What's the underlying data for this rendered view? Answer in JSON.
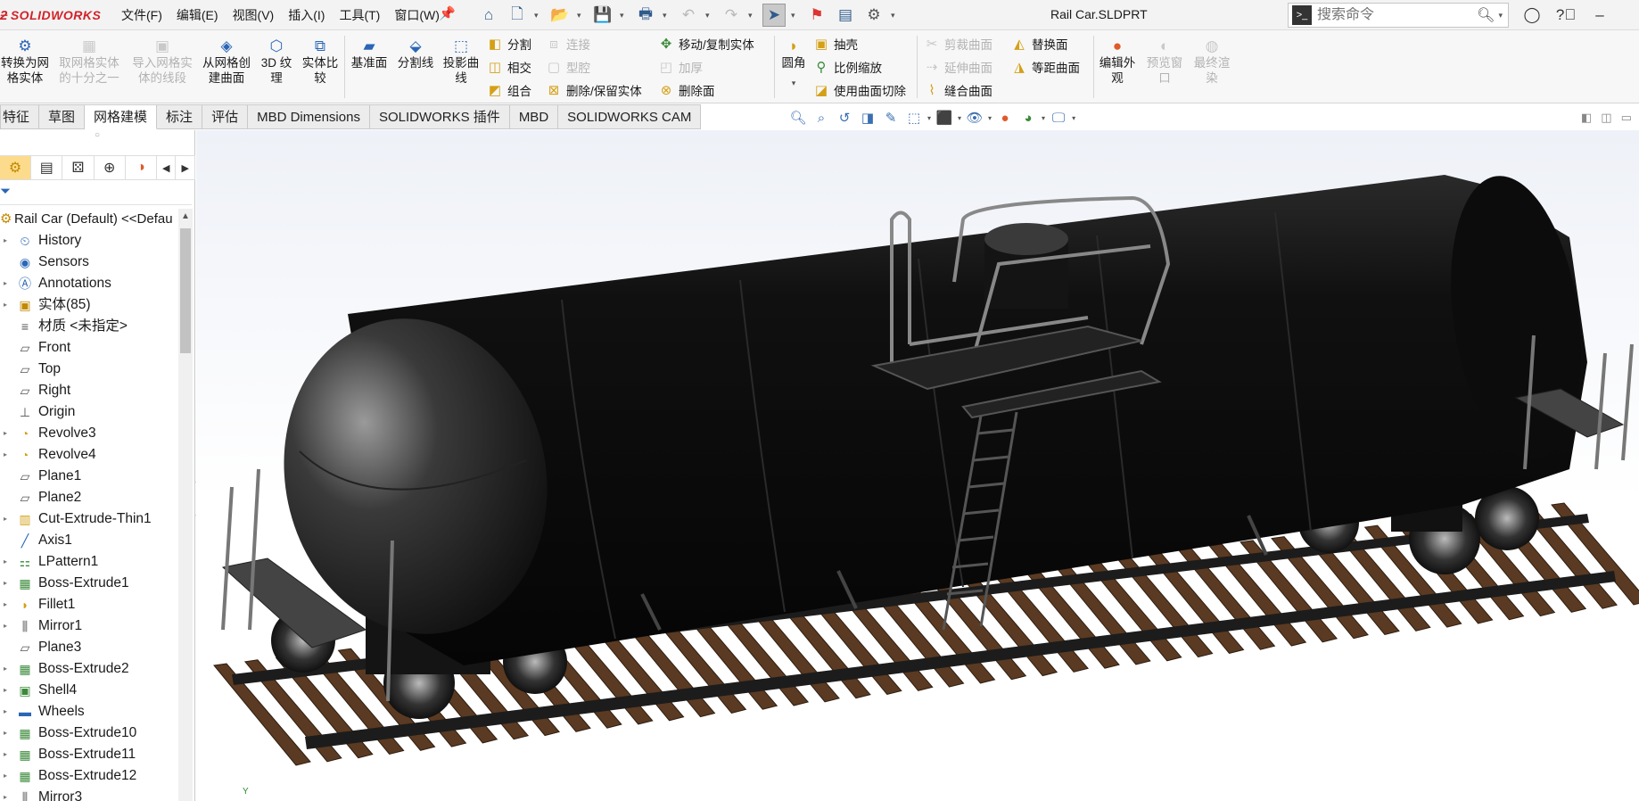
{
  "app": {
    "logo": "SOLIDWORKS",
    "document_title": "Rail Car.SLDPRT"
  },
  "menu": [
    {
      "label": "文件(F)"
    },
    {
      "label": "编辑(E)"
    },
    {
      "label": "视图(V)"
    },
    {
      "label": "插入(I)"
    },
    {
      "label": "工具(T)"
    },
    {
      "label": "窗口(W)"
    }
  ],
  "quick_access_icons": [
    "home-icon",
    "new-document-icon",
    "open-icon",
    "save-icon",
    "print-icon",
    "undo-icon",
    "redo-icon",
    "select-cursor-icon",
    "rebuild-icon",
    "file-properties-icon",
    "options-gear-icon"
  ],
  "search": {
    "placeholder": "搜索命令"
  },
  "ribbon": {
    "large_buttons": [
      {
        "label": "转换为网格实体",
        "enabled": true
      },
      {
        "label": "取网格实体的十分之一",
        "enabled": false
      },
      {
        "label": "导入网格实体的线段",
        "enabled": false
      },
      {
        "label": "从网格创建曲面",
        "enabled": true
      },
      {
        "label": "3D 纹理",
        "enabled": true
      },
      {
        "label": "实体比较",
        "enabled": true
      },
      {
        "label": "基准面",
        "enabled": true
      },
      {
        "label": "分割线",
        "enabled": true
      },
      {
        "label": "投影曲线",
        "enabled": true
      }
    ],
    "small_buttons_col1": [
      {
        "label": "分割",
        "enabled": true
      },
      {
        "label": "相交",
        "enabled": true
      },
      {
        "label": "组合",
        "enabled": true
      }
    ],
    "small_buttons_col2": [
      {
        "label": "连接",
        "enabled": false
      },
      {
        "label": "型腔",
        "enabled": false
      },
      {
        "label": "删除/保留实体",
        "enabled": true
      }
    ],
    "small_buttons_col3": [
      {
        "label": "移动/复制实体",
        "enabled": true
      },
      {
        "label": "加厚",
        "enabled": false
      },
      {
        "label": "删除面",
        "enabled": true
      }
    ],
    "fillet_label": "圆角",
    "small_buttons_col4": [
      {
        "label": "抽壳",
        "enabled": true
      },
      {
        "label": "比例缩放",
        "enabled": true
      },
      {
        "label": "使用曲面切除",
        "enabled": true
      }
    ],
    "small_buttons_col5": [
      {
        "label": "剪裁曲面",
        "enabled": false
      },
      {
        "label": "延伸曲面",
        "enabled": false
      },
      {
        "label": "缝合曲面",
        "enabled": true
      }
    ],
    "small_buttons_col6": [
      {
        "label": "替换面",
        "enabled": true
      },
      {
        "label": "等距曲面",
        "enabled": true
      }
    ],
    "render_buttons": [
      {
        "label": "编辑外观",
        "enabled": true
      },
      {
        "label": "预览窗口",
        "enabled": false
      },
      {
        "label": "最终渲染",
        "enabled": false
      }
    ]
  },
  "tabs": [
    {
      "label": "特征",
      "active": false
    },
    {
      "label": "草图",
      "active": false
    },
    {
      "label": "网格建模",
      "active": true
    },
    {
      "label": "标注",
      "active": false
    },
    {
      "label": "评估",
      "active": false
    },
    {
      "label": "MBD Dimensions",
      "active": false
    },
    {
      "label": "SOLIDWORKS 插件",
      "active": false
    },
    {
      "label": "MBD",
      "active": false
    },
    {
      "label": "SOLIDWORKS CAM",
      "active": false
    }
  ],
  "feature_tree": {
    "root": "Rail Car (Default) <<Defau",
    "items": [
      {
        "label": "History",
        "icon": "history-icon",
        "expandable": true
      },
      {
        "label": "Sensors",
        "icon": "sensor-icon",
        "expandable": false
      },
      {
        "label": "Annotations",
        "icon": "annotations-icon",
        "expandable": true
      },
      {
        "label": "实体(85)",
        "icon": "solid-bodies-icon",
        "expandable": true
      },
      {
        "label": "材质 <未指定>",
        "icon": "material-icon",
        "expandable": false
      },
      {
        "label": "Front",
        "icon": "plane-icon",
        "expandable": false
      },
      {
        "label": "Top",
        "icon": "plane-icon",
        "expandable": false
      },
      {
        "label": "Right",
        "icon": "plane-icon",
        "expandable": false
      },
      {
        "label": "Origin",
        "icon": "origin-icon",
        "expandable": false
      },
      {
        "label": "Revolve3",
        "icon": "revolve-icon",
        "expandable": true
      },
      {
        "label": "Revolve4",
        "icon": "revolve-icon",
        "expandable": true
      },
      {
        "label": "Plane1",
        "icon": "plane-icon",
        "expandable": false
      },
      {
        "label": "Plane2",
        "icon": "plane-icon",
        "expandable": false
      },
      {
        "label": "Cut-Extrude-Thin1",
        "icon": "cut-extrude-icon",
        "expandable": true
      },
      {
        "label": "Axis1",
        "icon": "axis-icon",
        "expandable": false
      },
      {
        "label": "LPattern1",
        "icon": "linear-pattern-icon",
        "expandable": true
      },
      {
        "label": "Boss-Extrude1",
        "icon": "boss-extrude-icon",
        "expandable": true
      },
      {
        "label": "Fillet1",
        "icon": "fillet-icon",
        "expandable": true
      },
      {
        "label": "Mirror1",
        "icon": "mirror-icon",
        "expandable": true
      },
      {
        "label": "Plane3",
        "icon": "plane-icon",
        "expandable": false
      },
      {
        "label": "Boss-Extrude2",
        "icon": "boss-extrude-icon",
        "expandable": true
      },
      {
        "label": "Shell4",
        "icon": "shell-icon",
        "expandable": true
      },
      {
        "label": "Wheels",
        "icon": "folder-icon",
        "expandable": true
      },
      {
        "label": "Boss-Extrude10",
        "icon": "boss-extrude-icon",
        "expandable": true
      },
      {
        "label": "Boss-Extrude11",
        "icon": "boss-extrude-icon",
        "expandable": true
      },
      {
        "label": "Boss-Extrude12",
        "icon": "boss-extrude-icon",
        "expandable": true
      },
      {
        "label": "Mirror3",
        "icon": "mirror-icon",
        "expandable": true
      }
    ]
  },
  "viewport": {
    "model": "rail tank car on track",
    "triad_label": "Y"
  },
  "colors": {
    "brand_red": "#d2232a",
    "accent_blue": "#2a66b5",
    "active_panel_tab": "#fcdc8c",
    "tank_black": "#111111",
    "tie_brown": "#5a3a22"
  }
}
